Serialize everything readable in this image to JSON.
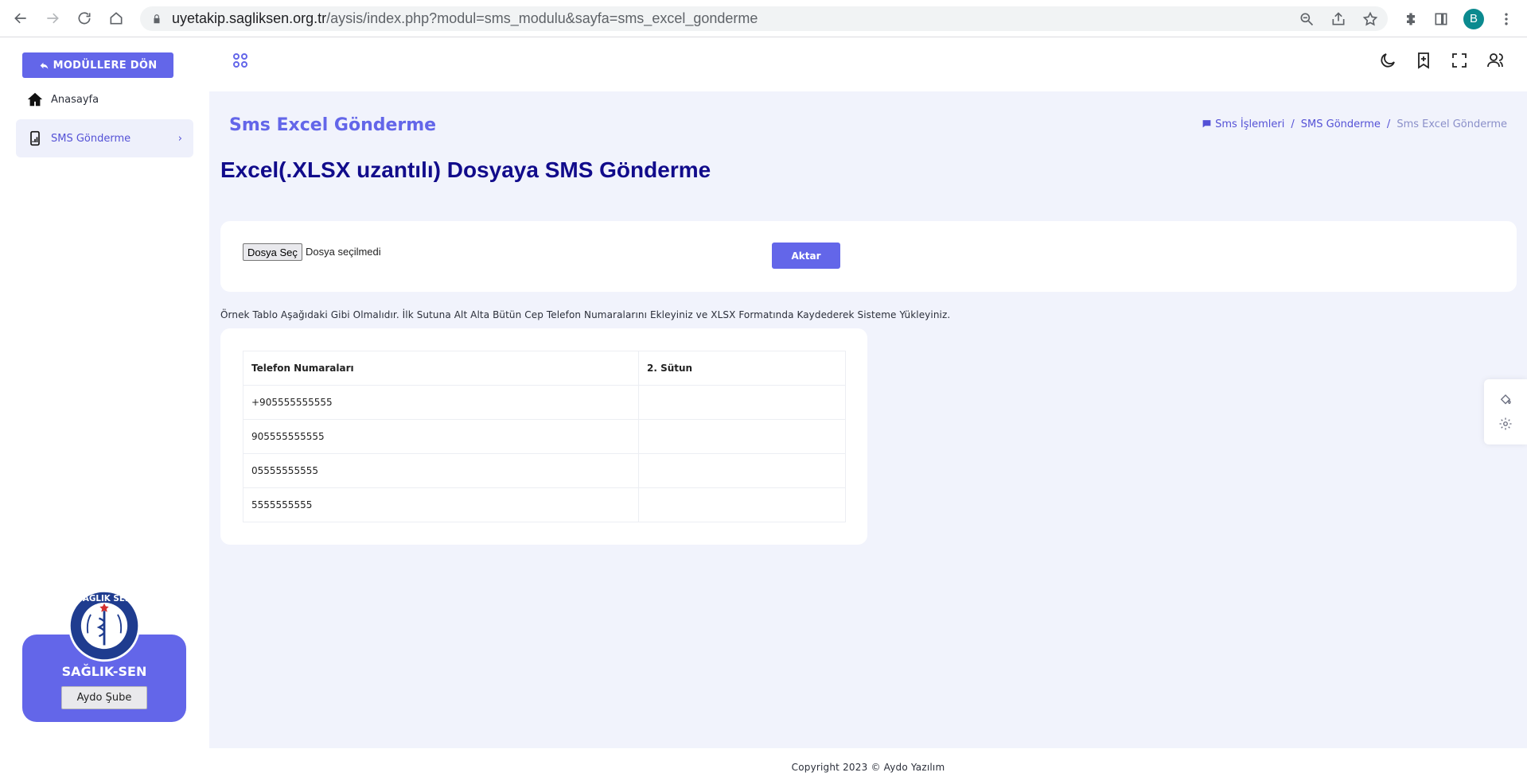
{
  "browser": {
    "url_host": "uyetakip.sagliksen.org.tr",
    "url_path": "/aysis/index.php?modul=sms_modulu&sayfa=sms_excel_gonderme",
    "profile_initial": "B"
  },
  "sidebar": {
    "back_label": "MODÜLLERE DÖN",
    "items": [
      {
        "label": "Anasayfa",
        "icon": "home-icon"
      },
      {
        "label": "SMS Gönderme",
        "icon": "mobile-icon"
      }
    ],
    "brand_name": "SAĞLIK-SEN",
    "branch_label": "Aydo Şube",
    "logo_text": "SAĞLIK SEN"
  },
  "page": {
    "title": "Sms Excel Gönderme",
    "breadcrumb": [
      "Sms İşlemleri",
      "SMS Gönderme",
      "Sms Excel Gönderme"
    ],
    "heading": "Excel(.XLSX uzantılı) Dosyaya SMS Gönderme"
  },
  "upload": {
    "file_button": "Dosya Seç",
    "file_status": "Dosya seçilmedi",
    "submit_label": "Aktar"
  },
  "instruction": "Örnek Tablo Aşağıdaki Gibi Olmalıdır. İlk Sutuna Alt Alta Bütün Cep Telefon Numaralarını Ekleyiniz ve XLSX Formatında Kaydederek Sisteme Yükleyiniz.",
  "sample_table": {
    "headers": [
      "Telefon Numaraları",
      "2. Sütun"
    ],
    "rows": [
      [
        "+905555555555",
        ""
      ],
      [
        "905555555555",
        ""
      ],
      [
        "05555555555",
        ""
      ],
      [
        "5555555555",
        ""
      ]
    ]
  },
  "footer": "Copyright 2023 © Aydo Yazılım",
  "colors": {
    "accent": "#6366e9",
    "heading": "#110b8b",
    "background": "#f1f3fc"
  }
}
